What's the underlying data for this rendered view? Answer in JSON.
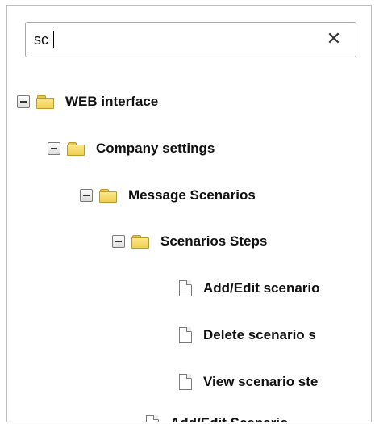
{
  "search": {
    "value": "sc",
    "clear_symbol": "✕"
  },
  "tree": {
    "nodes": [
      {
        "label": "WEB interface",
        "type": "folder",
        "expanded": true
      },
      {
        "label": "Company settings",
        "type": "folder",
        "expanded": true
      },
      {
        "label": "Message Scenarios",
        "type": "folder",
        "expanded": true
      },
      {
        "label": "Scenarios Steps",
        "type": "folder",
        "expanded": true
      },
      {
        "label": "Add/Edit scenario",
        "type": "file"
      },
      {
        "label": "Delete scenario s",
        "type": "file"
      },
      {
        "label": "View scenario ste",
        "type": "file"
      },
      {
        "label": "Add/Edit Scenario",
        "type": "file"
      }
    ]
  },
  "colors": {
    "folder": "#f0cf52",
    "border": "#bdbdbd"
  }
}
